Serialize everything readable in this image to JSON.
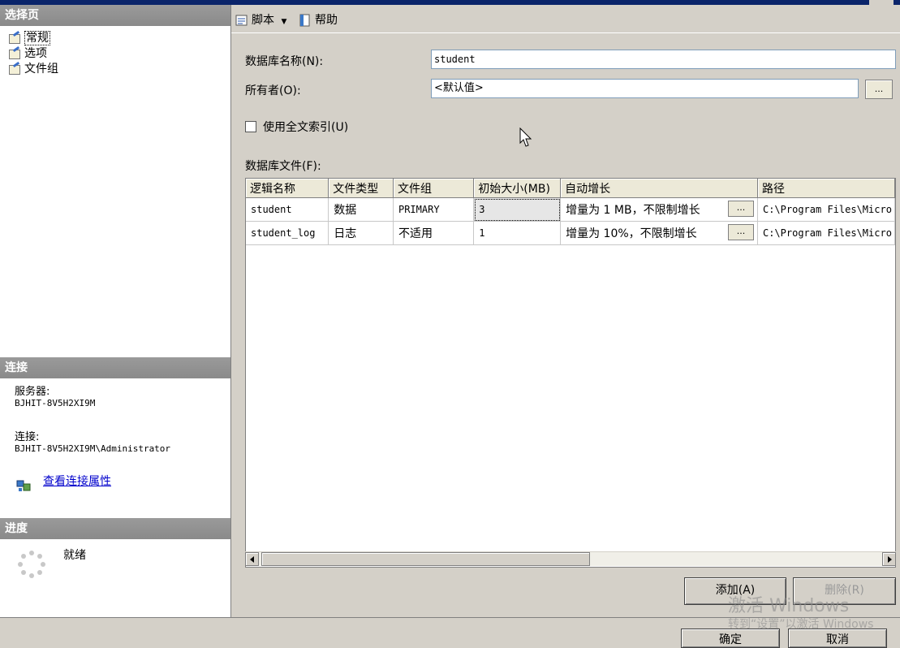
{
  "left_pane": {
    "select_page_header": "选择页",
    "pages": [
      {
        "label": "常规"
      },
      {
        "label": "选项"
      },
      {
        "label": "文件组"
      }
    ],
    "connection_header": "连接",
    "server_label": "服务器:",
    "server_value": "BJHIT-8V5H2XI9M",
    "connection_label": "连接:",
    "connection_value": "BJHIT-8V5H2XI9M\\Administrator",
    "view_connection_link": "查看连接属性",
    "progress_header": "进度",
    "progress_status": "就绪"
  },
  "toolbar": {
    "script_label": "脚本",
    "help_label": "帮助"
  },
  "form": {
    "db_name_label": "数据库名称(N):",
    "db_name_value": "student",
    "owner_label": "所有者(O):",
    "owner_value": "<默认值>",
    "browse_label": "...",
    "fulltext_label": "使用全文索引(U)",
    "fulltext_checked": false,
    "db_files_label": "数据库文件(F):"
  },
  "files_table": {
    "columns": [
      "逻辑名称",
      "文件类型",
      "文件组",
      "初始大小(MB)",
      "自动增长",
      "路径"
    ],
    "rows": [
      {
        "logical_name": "student",
        "file_type": "数据",
        "filegroup": "PRIMARY",
        "initial_size": "3",
        "autogrowth": "增量为 1 MB，不限制增长",
        "path": "C:\\Program Files\\Micro"
      },
      {
        "logical_name": "student_log",
        "file_type": "日志",
        "filegroup": "不适用",
        "initial_size": "1",
        "autogrowth": "增量为 10%，不限制增长",
        "path": "C:\\Program Files\\Micro"
      }
    ],
    "cell_button_label": "..."
  },
  "buttons": {
    "add_label": "添加(A)",
    "remove_label": "删除(R)",
    "ok_label": "确定",
    "cancel_label": "取消"
  },
  "watermark": {
    "line1": "激活 Windows",
    "line2": "转到“设置”以激活 Windows"
  },
  "colors": {
    "section_header": "#8a8a8a",
    "link": "#0000cc",
    "title_bar": "#0a246a"
  }
}
